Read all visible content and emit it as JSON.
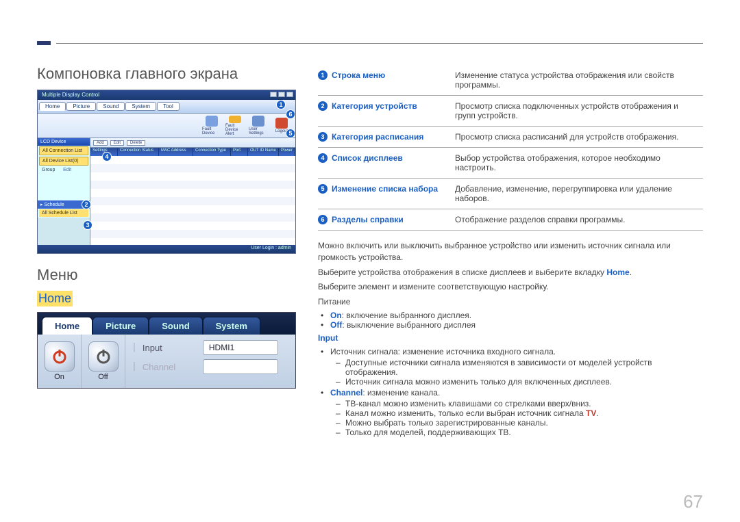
{
  "section_title": "Компоновка главного экрана",
  "menu_heading": "Меню",
  "home_label": "Home",
  "page_number": "67",
  "app1": {
    "title": "Multiple Display Control",
    "tabs": [
      "Home",
      "Picture",
      "Sound",
      "System",
      "Tool"
    ],
    "tool_buttons": [
      {
        "label": "Fault Device"
      },
      {
        "label": "Fault Device Alert"
      },
      {
        "label": "User Settings"
      },
      {
        "label": "Logout"
      }
    ],
    "sidebar": {
      "head": "LCD Device",
      "items": [
        "All Connection List",
        "All Device List(0)"
      ],
      "group_label": "Group",
      "edit_label": "Edit",
      "sched_head": "Schedule",
      "sched_item": "All Schedule List"
    },
    "grid_buttons": [
      "Add",
      "Edit",
      "Delete"
    ],
    "grid_headers": [
      "Settings",
      "Connection Status",
      "MAC Address",
      "Connection Type",
      "Port",
      "OUT ID Name",
      "Power"
    ],
    "status": "User Login : admin"
  },
  "app2": {
    "tabs": [
      "Home",
      "Picture",
      "Sound",
      "System"
    ],
    "on_label": "On",
    "off_label": "Off",
    "input_label": "Input",
    "input_value": "HDMI1",
    "channel_label": "Channel"
  },
  "table_rows": [
    {
      "num": "1",
      "name": "Строка меню",
      "desc": "Изменение статуса устройства отображения или свойств программы."
    },
    {
      "num": "2",
      "name": "Категория устройств",
      "desc": "Просмотр списка подключенных устройств отображения и групп устройств."
    },
    {
      "num": "3",
      "name": "Категория расписания",
      "desc": "Просмотр списка расписаний для устройств отображения."
    },
    {
      "num": "4",
      "name": "Список дисплеев",
      "desc": "Выбор устройства отображения, которое необходимо настроить."
    },
    {
      "num": "5",
      "name": "Изменение списка набора",
      "desc": "Добавление, изменение, перегруппировка или удаление наборов."
    },
    {
      "num": "6",
      "name": "Разделы справки",
      "desc": "Отображение разделов справки программы."
    }
  ],
  "paras": {
    "p1": "Можно включить или выключить выбранное устройство или изменить источник сигнала или громкость устройства.",
    "p2_a": "Выберите устройства отображения в списке дисплеев и выберите вкладку ",
    "p2_b": "Home",
    "p2_c": ".",
    "p3": "Выберите элемент и измените соответствующую настройку.",
    "p4": "Питание",
    "on_kw": "On",
    "on_txt": ": включение выбранного дисплея.",
    "off_kw": "Off",
    "off_txt": ": выключение выбранного дисплея",
    "input_kw": "Input",
    "src_li": "Источник сигнала: изменение источника входного сигнала.",
    "src_sub1": "Доступные источники сигнала изменяются в зависимости от моделей устройств отображения.",
    "src_sub2": "Источник сигнала можно изменить только для включенных дисплеев.",
    "channel_kw": "Channel",
    "channel_txt": ": изменение канала.",
    "ch_sub1": "ТВ-канал можно изменить клавишами со стрелками вверх/вниз.",
    "ch_sub2_a": "Канал можно изменить, только если выбран источник сигнала ",
    "ch_sub2_b": "TV",
    "ch_sub2_c": ".",
    "ch_sub3": "Можно выбрать только зарегистрированные каналы.",
    "ch_sub4": "Только для моделей, поддерживающих ТВ."
  }
}
